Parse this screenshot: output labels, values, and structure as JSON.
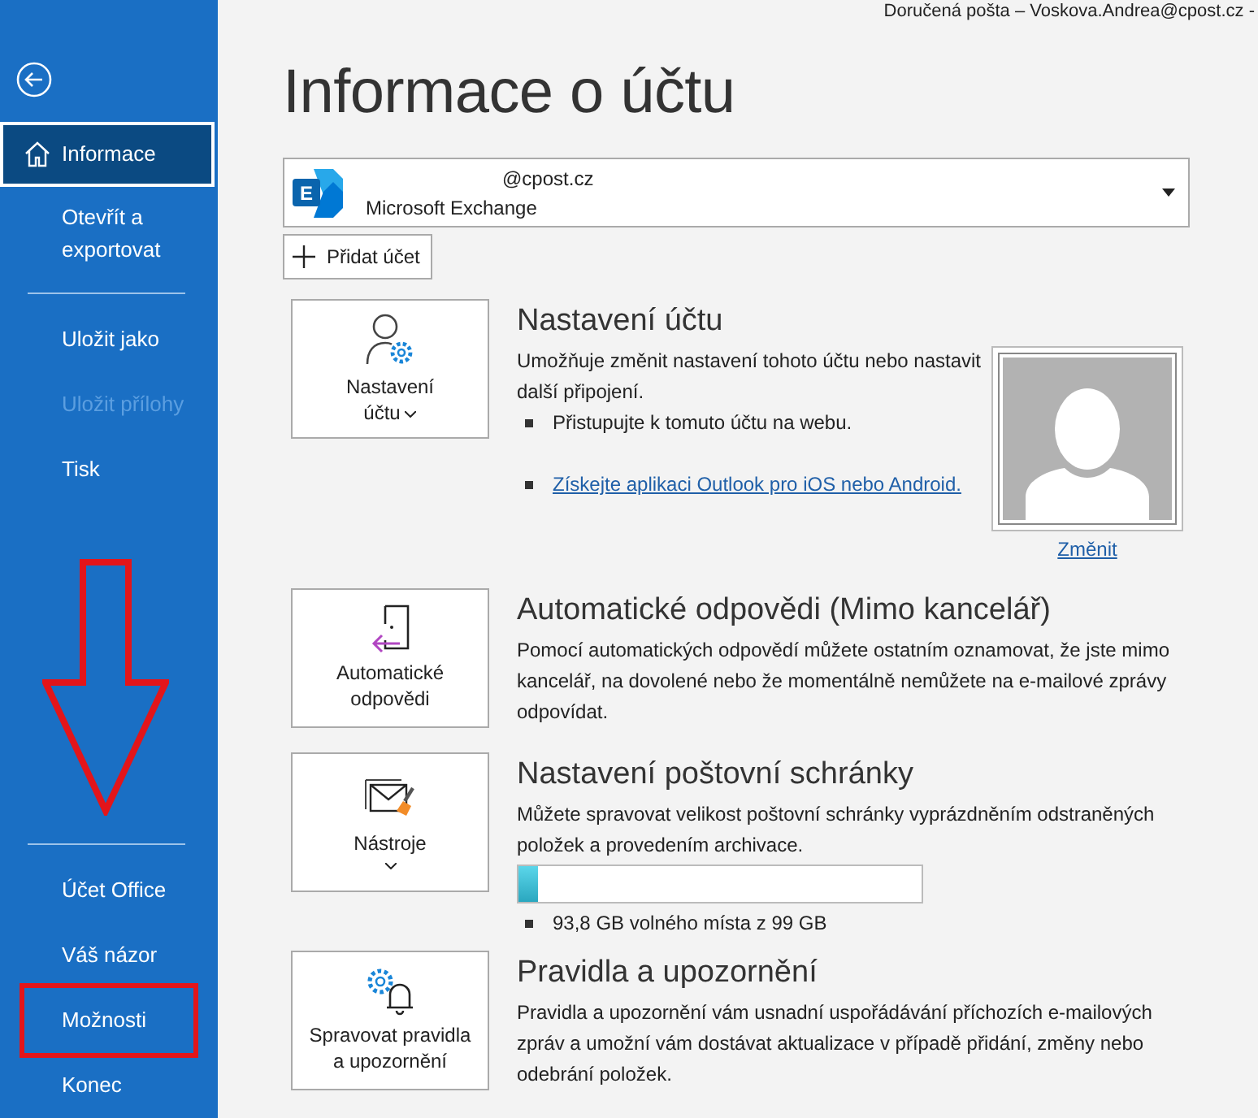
{
  "title_bar": "Doručená pošta – Voskova.Andrea@cpost.cz -",
  "sidebar": {
    "groups": [
      [
        {
          "label": "Informace",
          "selected": true,
          "disabled": false,
          "highlighted": false
        },
        {
          "label": "Otevřít a\nexportovat",
          "selected": false,
          "disabled": false,
          "highlighted": false
        }
      ],
      [
        {
          "label": "Uložit jako",
          "selected": false,
          "disabled": false,
          "highlighted": false
        },
        {
          "label": "Uložit přílohy",
          "selected": false,
          "disabled": true,
          "highlighted": false
        },
        {
          "label": "Tisk",
          "selected": false,
          "disabled": false,
          "highlighted": false
        }
      ],
      [
        {
          "label": "Účet Office",
          "selected": false,
          "disabled": false,
          "highlighted": false
        },
        {
          "label": "Váš názor",
          "selected": false,
          "disabled": false,
          "highlighted": false
        },
        {
          "label": "Možnosti",
          "selected": false,
          "disabled": false,
          "highlighted": true
        },
        {
          "label": "Konec",
          "selected": false,
          "disabled": false,
          "highlighted": false
        }
      ]
    ]
  },
  "annotations": [
    {
      "kind": "down-arrow"
    }
  ],
  "page_title": "Informace o účtu",
  "account": {
    "logo_letter": "E",
    "email": "@cpost.cz",
    "type": "Microsoft Exchange"
  },
  "add_account_button": "Přidat účet",
  "sections": [
    {
      "kind": "account-settings",
      "tile_label": "Nastavení\núčtu",
      "dropdown": true,
      "heading": "Nastavení účtu",
      "description": "Umožňuje změnit nastavení tohoto účtu nebo nastavit další připojení.",
      "bullets": [
        {
          "text": "Přistupujte k tomuto účtu na webu.",
          "link": false
        },
        {
          "text": "Získejte aplikaci Outlook pro iOS nebo Android.",
          "link": true
        }
      ],
      "photo_link": "Změnit"
    },
    {
      "kind": "auto-reply",
      "tile_label": "Automatické\nodpovědi",
      "dropdown": false,
      "heading": "Automatické odpovědi (Mimo kancelář)",
      "description": "Pomocí automatických odpovědí můžete ostatním oznamovat, že jste mimo kancelář, na dovolené nebo že momentálně nemůžete na e-mailové zprávy odpovídat."
    },
    {
      "kind": "mailbox",
      "tile_label": "Nástroje",
      "dropdown": true,
      "heading": "Nastavení poštovní schránky",
      "description": "Můžete spravovat velikost poštovní schránky vyprázdněním odstraněných položek a provedením archivace.",
      "storage": {
        "level": 0.05,
        "reading": "93,8 GB volného místa z 99 GB"
      }
    },
    {
      "kind": "rules",
      "tile_label": "Spravovat pravidla\na upozornění",
      "dropdown": false,
      "heading": "Pravidla a upozornění",
      "description": "Pravidla a upozornění vám usnadní uspořádávání příchozích e-mailových zpráv a umožní vám dostávat aktualizace v případě přidání, změny nebo odebrání položek."
    }
  ]
}
